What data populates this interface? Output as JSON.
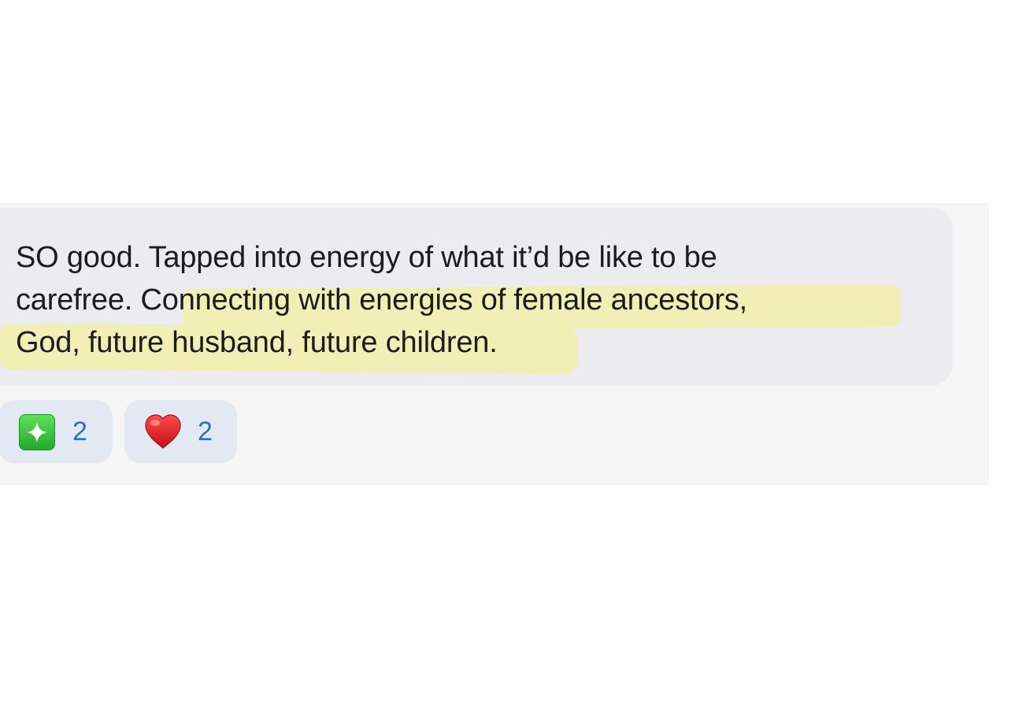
{
  "message": {
    "lines": [
      "SO good. Tapped into energy of what it’d be like to be",
      "carefree. Connecting with energies of female ancestors,",
      "God, future husband, future children."
    ]
  },
  "reactions": [
    {
      "icon": "sparkle-icon",
      "count": "2"
    },
    {
      "icon": "heart-icon",
      "count": "2"
    }
  ],
  "colors": {
    "highlight": "#f2efb6",
    "bubble": "#ebebf0",
    "reaction_background": "#e3e9f3",
    "count_text": "#2f6ec4"
  }
}
